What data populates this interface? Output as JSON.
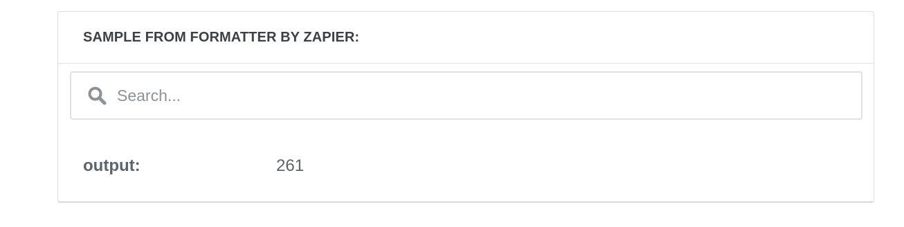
{
  "panel": {
    "title": "SAMPLE FROM FORMATTER BY ZAPIER:"
  },
  "search": {
    "icon": "search-icon",
    "placeholder": "Search...",
    "value": ""
  },
  "fields": [
    {
      "key": "output:",
      "value": "261"
    }
  ],
  "colors": {
    "title": "#3d4145",
    "border": "#dcdfe1",
    "icon": "#8d9297",
    "text": "#5e6468"
  }
}
